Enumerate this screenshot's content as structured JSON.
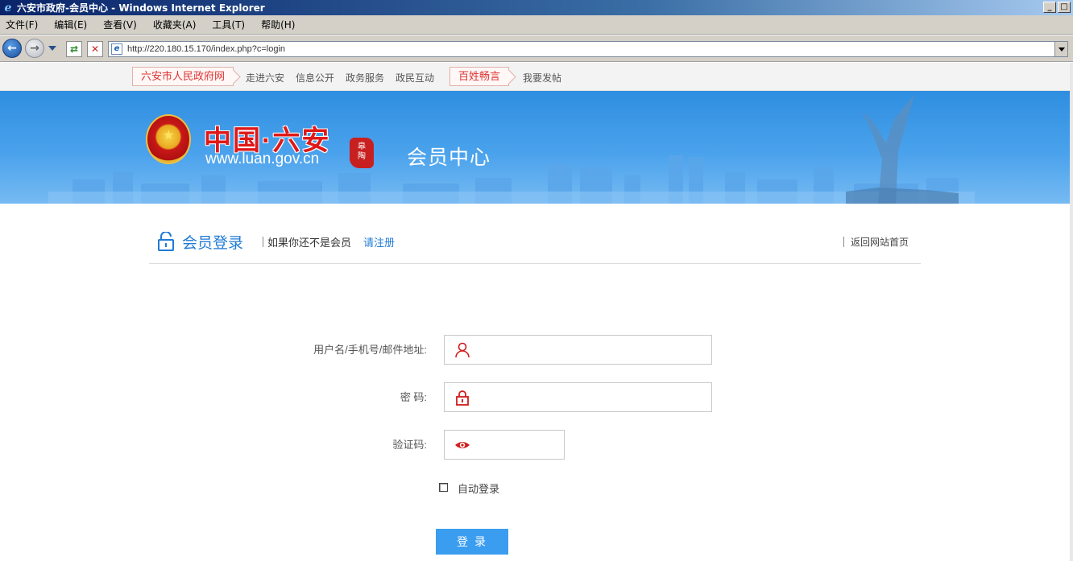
{
  "window": {
    "title": "六安市政府-会员中心 - Windows Internet Explorer"
  },
  "menu": {
    "items": [
      "文件(F)",
      "编辑(E)",
      "查看(V)",
      "收藏夹(A)",
      "工具(T)",
      "帮助(H)"
    ]
  },
  "address_bar": {
    "url": "http://220.180.15.170/index.php?c=login"
  },
  "site_nav": {
    "home_tag": "六安市人民政府网",
    "links": [
      "走进六安",
      "信息公开",
      "政务服务",
      "政民互动"
    ],
    "forum_tag": "百姓畅言",
    "post_link": "我要发帖"
  },
  "banner": {
    "title": "中国·六安",
    "url": "www.luan.gov.cn",
    "subtitle": "会员中心"
  },
  "login_header": {
    "title": "会员登录",
    "not_member_text": "如果你还不是会员",
    "register_link": "请注册",
    "back_home": "返回网站首页"
  },
  "form": {
    "username_label": "用户名/手机号/邮件地址:",
    "password_label": "密 码:",
    "captcha_label": "验证码:",
    "auto_login_label": "自动登录",
    "submit_label": "登录"
  },
  "colors": {
    "accent_blue": "#1f7bd6",
    "button_blue": "#3b9df0",
    "icon_red": "#d21c1c",
    "banner_blue": "#2f8ee0"
  }
}
